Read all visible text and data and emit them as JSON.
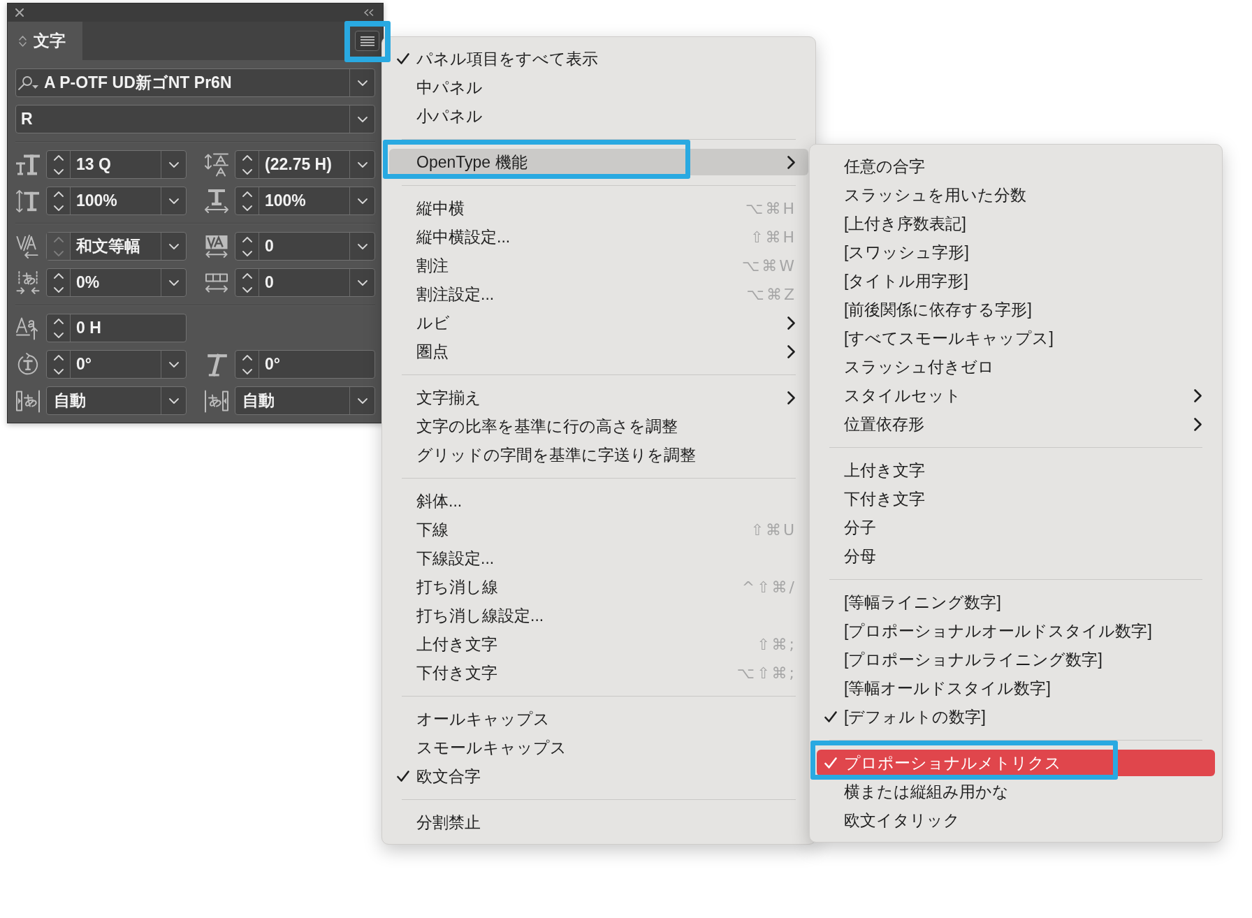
{
  "character_panel": {
    "tab": {
      "label": "文字",
      "selected": true
    },
    "menu_button": {
      "annotated": true
    },
    "font_family": {
      "value": "A P-OTF UD新ゴNT Pr6N"
    },
    "font_style": {
      "value": "R"
    },
    "field_groups": [
      {
        "rows": [
          {
            "fields": [
              {
                "kind": "size",
                "value": "13 Q",
                "stepper": true,
                "stepper_disabled": false,
                "dropdown": true
              },
              {
                "kind": "leading",
                "value": "(22.75 H)",
                "stepper": true,
                "stepper_disabled": false,
                "dropdown": true
              }
            ]
          },
          {
            "fields": [
              {
                "kind": "vscale",
                "value": "100%",
                "stepper": true,
                "stepper_disabled": false,
                "dropdown": true
              },
              {
                "kind": "hscale",
                "value": "100%",
                "stepper": true,
                "stepper_disabled": false,
                "dropdown": true
              }
            ]
          }
        ]
      },
      {
        "rows": [
          {
            "fields": [
              {
                "kind": "kerning",
                "value": "和文等幅",
                "stepper": true,
                "stepper_disabled": true,
                "dropdown": true
              },
              {
                "kind": "tracking",
                "value": "0",
                "stepper": true,
                "stepper_disabled": false,
                "dropdown": true
              }
            ]
          },
          {
            "fields": [
              {
                "kind": "tsume",
                "value": "0%",
                "stepper": true,
                "stepper_disabled": false,
                "dropdown": true
              },
              {
                "kind": "grid",
                "value": "0",
                "stepper": true,
                "stepper_disabled": false,
                "dropdown": true
              }
            ]
          }
        ]
      },
      {
        "rows": [
          {
            "fields": [
              {
                "kind": "baseline",
                "value": "0 H",
                "stepper": true,
                "stepper_disabled": false,
                "dropdown": false
              }
            ]
          },
          {
            "fields": [
              {
                "kind": "rotation",
                "value": "0°",
                "stepper": true,
                "stepper_disabled": false,
                "dropdown": true
              },
              {
                "kind": "skew",
                "value": "0°",
                "stepper": true,
                "stepper_disabled": false,
                "dropdown": false
              }
            ]
          },
          {
            "fields": [
              {
                "kind": "before",
                "value": "自動",
                "stepper": false,
                "dropdown": true
              },
              {
                "kind": "after",
                "value": "自動",
                "stepper": false,
                "dropdown": true
              }
            ]
          }
        ]
      }
    ]
  },
  "panel_menu": {
    "sections": [
      {
        "items": [
          {
            "label": "パネル項目をすべて表示",
            "checked": true,
            "expanded": false,
            "submenu": false,
            "annotated": false
          },
          {
            "label": "中パネル",
            "checked": false,
            "expanded": false,
            "submenu": false,
            "annotated": false
          },
          {
            "label": "小パネル",
            "checked": false,
            "expanded": false,
            "submenu": false,
            "annotated": false
          }
        ]
      },
      {
        "items": [
          {
            "label": "OpenType 機能",
            "checked": false,
            "expanded": true,
            "submenu": true,
            "annotated": true
          }
        ]
      },
      {
        "items": [
          {
            "label": "縦中横",
            "shortcut": "⌥⌘H",
            "checked": false,
            "expanded": false,
            "submenu": false,
            "annotated": false
          },
          {
            "label": "縦中横設定...",
            "shortcut": "⇧⌘H",
            "checked": false,
            "expanded": false,
            "submenu": false,
            "annotated": false
          },
          {
            "label": "割注",
            "shortcut": "⌥⌘W",
            "checked": false,
            "expanded": false,
            "submenu": false,
            "annotated": false
          },
          {
            "label": "割注設定...",
            "shortcut": "⌥⌘Z",
            "checked": false,
            "expanded": false,
            "submenu": false,
            "annotated": false
          },
          {
            "label": "ルビ",
            "checked": false,
            "expanded": false,
            "submenu": true,
            "annotated": false
          },
          {
            "label": "圏点",
            "checked": false,
            "expanded": false,
            "submenu": true,
            "annotated": false
          }
        ]
      },
      {
        "items": [
          {
            "label": "文字揃え",
            "checked": false,
            "expanded": false,
            "submenu": true,
            "annotated": false
          },
          {
            "label": "文字の比率を基準に行の高さを調整",
            "checked": false,
            "expanded": false,
            "submenu": false,
            "annotated": false
          },
          {
            "label": "グリッドの字間を基準に字送りを調整",
            "checked": false,
            "expanded": false,
            "submenu": false,
            "annotated": false
          }
        ]
      },
      {
        "items": [
          {
            "label": "斜体...",
            "checked": false,
            "expanded": false,
            "submenu": false,
            "annotated": false
          },
          {
            "label": "下線",
            "shortcut": "⇧⌘U",
            "checked": false,
            "expanded": false,
            "submenu": false,
            "annotated": false
          },
          {
            "label": "下線設定...",
            "checked": false,
            "expanded": false,
            "submenu": false,
            "annotated": false
          },
          {
            "label": "打ち消し線",
            "shortcut": "^⇧⌘/",
            "checked": false,
            "expanded": false,
            "submenu": false,
            "annotated": false
          },
          {
            "label": "打ち消し線設定...",
            "checked": false,
            "expanded": false,
            "submenu": false,
            "annotated": false
          },
          {
            "label": "上付き文字",
            "shortcut": "⇧⌘;",
            "checked": false,
            "expanded": false,
            "submenu": false,
            "annotated": false
          },
          {
            "label": "下付き文字",
            "shortcut": "⌥⇧⌘;",
            "checked": false,
            "expanded": false,
            "submenu": false,
            "annotated": false
          }
        ]
      },
      {
        "items": [
          {
            "label": "オールキャップス",
            "checked": false,
            "expanded": false,
            "submenu": false,
            "annotated": false
          },
          {
            "label": "スモールキャップス",
            "checked": false,
            "expanded": false,
            "submenu": false,
            "annotated": false
          },
          {
            "label": "欧文合字",
            "checked": true,
            "expanded": false,
            "submenu": false,
            "annotated": false
          }
        ]
      },
      {
        "items": [
          {
            "label": "分割禁止",
            "checked": false,
            "expanded": false,
            "submenu": false,
            "annotated": false
          }
        ]
      }
    ]
  },
  "opentype_submenu": {
    "sections": [
      {
        "items": [
          {
            "label": "任意の合字",
            "checked": false,
            "selected": false,
            "submenu": false,
            "annotated": false
          },
          {
            "label": "スラッシュを用いた分数",
            "checked": false,
            "selected": false,
            "submenu": false,
            "annotated": false
          },
          {
            "label": "[上付き序数表記]",
            "checked": false,
            "selected": false,
            "submenu": false,
            "annotated": false
          },
          {
            "label": "[スワッシュ字形]",
            "checked": false,
            "selected": false,
            "submenu": false,
            "annotated": false
          },
          {
            "label": "[タイトル用字形]",
            "checked": false,
            "selected": false,
            "submenu": false,
            "annotated": false
          },
          {
            "label": "[前後関係に依存する字形]",
            "checked": false,
            "selected": false,
            "submenu": false,
            "annotated": false
          },
          {
            "label": "[すべてスモールキャップス]",
            "checked": false,
            "selected": false,
            "submenu": false,
            "annotated": false
          },
          {
            "label": "スラッシュ付きゼロ",
            "checked": false,
            "selected": false,
            "submenu": false,
            "annotated": false
          },
          {
            "label": "スタイルセット",
            "checked": false,
            "selected": false,
            "submenu": true,
            "annotated": false
          },
          {
            "label": "位置依存形",
            "checked": false,
            "selected": false,
            "submenu": true,
            "annotated": false
          }
        ]
      },
      {
        "items": [
          {
            "label": "上付き文字",
            "checked": false,
            "selected": false,
            "submenu": false,
            "annotated": false
          },
          {
            "label": "下付き文字",
            "checked": false,
            "selected": false,
            "submenu": false,
            "annotated": false
          },
          {
            "label": "分子",
            "checked": false,
            "selected": false,
            "submenu": false,
            "annotated": false
          },
          {
            "label": "分母",
            "checked": false,
            "selected": false,
            "submenu": false,
            "annotated": false
          }
        ]
      },
      {
        "items": [
          {
            "label": "[等幅ライニング数字]",
            "checked": false,
            "selected": false,
            "submenu": false,
            "annotated": false
          },
          {
            "label": "[プロポーショナルオールドスタイル数字]",
            "checked": false,
            "selected": false,
            "submenu": false,
            "annotated": false
          },
          {
            "label": "[プロポーショナルライニング数字]",
            "checked": false,
            "selected": false,
            "submenu": false,
            "annotated": false
          },
          {
            "label": "[等幅オールドスタイル数字]",
            "checked": false,
            "selected": false,
            "submenu": false,
            "annotated": false
          },
          {
            "label": "[デフォルトの数字]",
            "checked": true,
            "selected": false,
            "submenu": false,
            "annotated": false
          }
        ]
      },
      {
        "items": [
          {
            "label": "プロポーショナルメトリクス",
            "checked": true,
            "selected": true,
            "submenu": false,
            "annotated": true
          },
          {
            "label": "横または縦組み用かな",
            "checked": false,
            "selected": false,
            "submenu": false,
            "annotated": false
          },
          {
            "label": "欧文イタリック",
            "checked": false,
            "selected": false,
            "submenu": false,
            "annotated": false
          }
        ]
      }
    ]
  }
}
